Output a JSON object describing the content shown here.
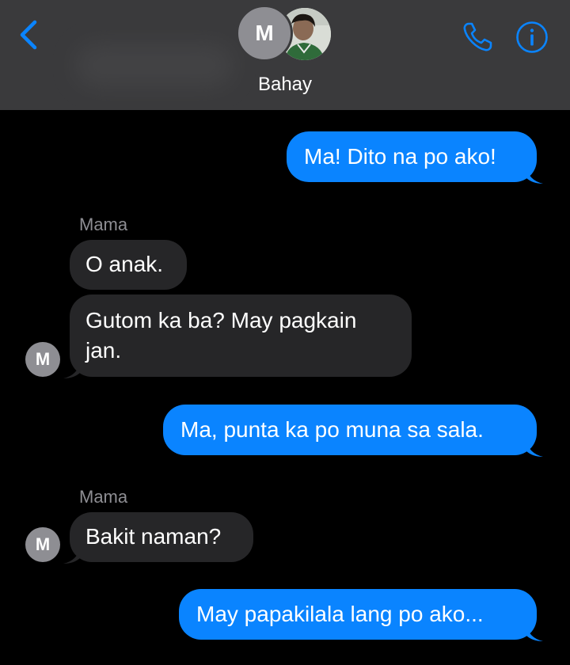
{
  "header": {
    "contact_name": "Bahay",
    "avatar_initial": "M",
    "back_icon": "chevron-left-icon",
    "call_icon": "phone-icon",
    "info_icon": "info-icon",
    "accent_color": "#0a84ff"
  },
  "messages": [
    {
      "direction": "sent",
      "text": "Ma! Dito na po ako!"
    },
    {
      "direction": "received",
      "sender": "Mama",
      "text": "O anak."
    },
    {
      "direction": "received",
      "text": "Gutom ka ba? May pagkain jan.",
      "avatar_initial": "M"
    },
    {
      "direction": "sent",
      "text": "Ma, punta ka po muna sa sala."
    },
    {
      "direction": "received",
      "sender": "Mama",
      "text": "Bakit naman?",
      "avatar_initial": "M"
    },
    {
      "direction": "sent",
      "text": "May papakilala lang po ako..."
    }
  ],
  "colors": {
    "sent_bubble": "#0a84ff",
    "received_bubble": "#262628",
    "header_bg": "#3a3a3c",
    "background": "#000000"
  }
}
